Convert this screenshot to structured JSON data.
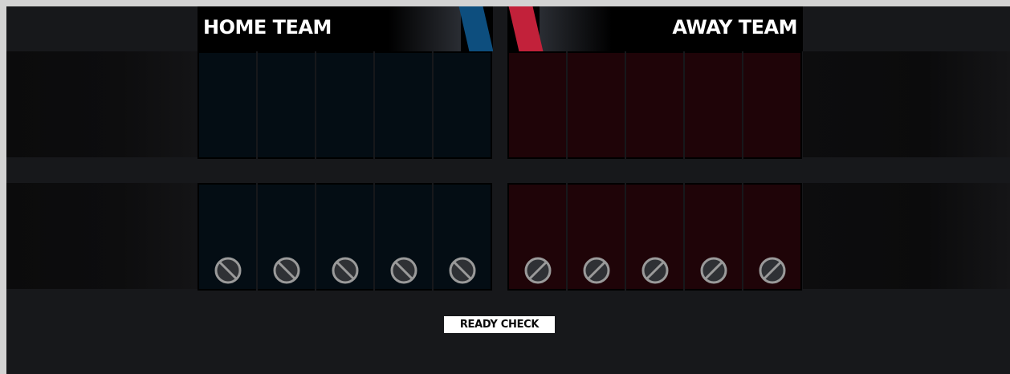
{
  "teams": {
    "home": {
      "name": "HOME TEAM",
      "accent_color": "#0d4e7e",
      "slot_color": "#040d14",
      "pick_slots": 5,
      "ban_slots": 5
    },
    "away": {
      "name": "AWAY TEAM",
      "accent_color": "#c2213a",
      "slot_color": "#1f0408",
      "pick_slots": 5,
      "ban_slots": 5
    }
  },
  "icons": {
    "ban": "prohibited-circle-icon"
  },
  "actions": {
    "ready_label": "READY CHECK"
  }
}
